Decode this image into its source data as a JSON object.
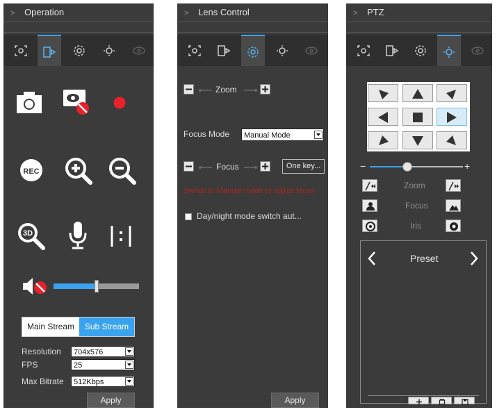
{
  "operation": {
    "title": "Operation",
    "main_stream_label": "Main Stream",
    "sub_stream_label": "Sub Stream",
    "resolution_label": "Resolution",
    "resolution_value": "704x576",
    "fps_label": "FPS",
    "fps_value": "25",
    "bitrate_label": "Max Bitrate",
    "bitrate_value": "512Kbps",
    "apply_label": "Apply",
    "rec_label": "REC",
    "volume_level": 0.5,
    "accent_color": "#3aa3f0",
    "record_color": "#e8212a"
  },
  "lens": {
    "title": "Lens Control",
    "zoom_label": "Zoom",
    "focus_mode_label": "Focus Mode",
    "focus_mode_value": "Manual Mode",
    "focus_label": "Focus",
    "one_key_label": "One key...",
    "warning_text": "Switch to Manual mode to adjust focus",
    "warning_color": "#c81e1e",
    "day_night_label": "Day/night mode switch aut...",
    "apply_label": "Apply"
  },
  "ptz": {
    "title": "PTZ",
    "zoom_label": "Zoom",
    "focus_label": "Focus",
    "iris_label": "Iris",
    "preset_label": "Preset",
    "speed_level": 0.4
  }
}
